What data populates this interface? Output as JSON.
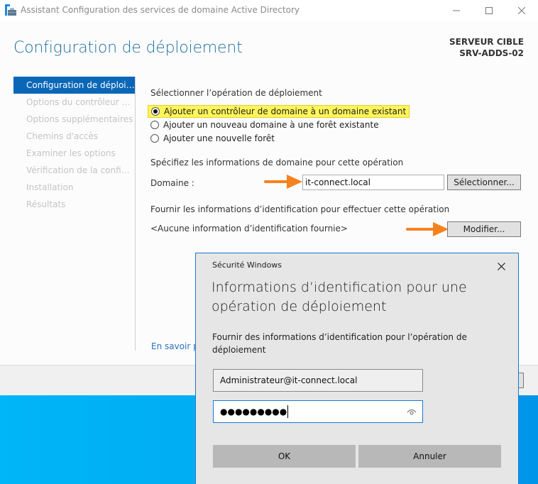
{
  "window": {
    "title": "Assistant Configuration des services de domaine Active Directory",
    "icon": "ad-wizard-icon",
    "controls": [
      "minimize-icon",
      "maximize-icon",
      "close-icon"
    ]
  },
  "header": {
    "page_title": "Configuration de déploiement",
    "target_label": "SERVEUR CIBLE",
    "target_name": "SRV-ADDS-02"
  },
  "sidebar": {
    "items": [
      {
        "label": "Configuration de déploiement",
        "active": true
      },
      {
        "label": "Options du contrôleur de domaine",
        "active": false
      },
      {
        "label": "Options supplémentaires",
        "active": false
      },
      {
        "label": "Chemins d'accès",
        "active": false
      },
      {
        "label": "Examiner les options",
        "active": false
      },
      {
        "label": "Vérification de la configuration requise",
        "active": false
      },
      {
        "label": "Installation",
        "active": false
      },
      {
        "label": "Résultats",
        "active": false
      }
    ]
  },
  "main": {
    "operation_heading": "Sélectionner l’opération de déploiement",
    "operations": [
      {
        "label": "Ajouter un contrôleur de domaine à un domaine existant",
        "selected": true
      },
      {
        "label": "Ajouter un nouveau domaine à une forêt existante",
        "selected": false
      },
      {
        "label": "Ajouter une nouvelle forêt",
        "selected": false
      }
    ],
    "domain_heading": "Spécifiez les informations de domaine pour cette opération",
    "domain_label": "Domaine :",
    "domain_value": "it-connect.local",
    "select_button": "Sélectionner...",
    "credentials_heading": "Fournir les informations d’identification pour effectuer cette opération",
    "credentials_status": "<Aucune information d’identification fournie>",
    "modify_button": "Modifier...",
    "learn_more": "En savoir plus"
  },
  "annotations": {
    "arrow_color": "#f5821f",
    "highlight_color": "#fdf55a"
  },
  "dialog": {
    "caption": "Sécurité Windows",
    "title": "Informations d’identification pour une opération de déploiement",
    "description": "Fournir des informations d’identification pour l’opération de déploiement",
    "username": "Administrateur@it-connect.local",
    "password_masked": "●●●●●●●●●",
    "ok_button": "OK",
    "cancel_button": "Annuler"
  },
  "colors": {
    "accent": "#0a67b8",
    "title": "#1e6fa0",
    "link": "#2b6fc2",
    "dialog_border": "#1a78d2"
  }
}
